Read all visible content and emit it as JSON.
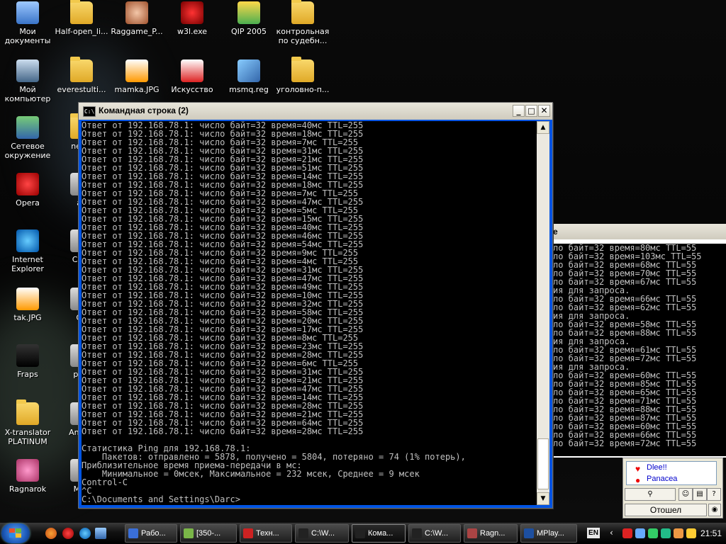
{
  "desktop_icons": [
    {
      "label": "Мои документы",
      "icon": "my-documents-icon"
    },
    {
      "label": "Half-open_li...",
      "icon": "folder-icon"
    },
    {
      "label": "Raggame_P...",
      "icon": "anime-character-icon"
    },
    {
      "label": "w3l.exe",
      "icon": "biohazard-icon"
    },
    {
      "label": "QIP 2005",
      "icon": "qip-icon"
    },
    {
      "label": "контрольная по судебн...",
      "icon": "folder-icon"
    },
    {
      "label": "Мой компьютер",
      "icon": "my-computer-icon"
    },
    {
      "label": "everestulti...",
      "icon": "folder-icon"
    },
    {
      "label": "mamka.JPG",
      "icon": "jpg-file-icon"
    },
    {
      "label": "Искусство",
      "icon": "pdf-file-icon"
    },
    {
      "label": "msmq.reg",
      "icon": "registry-file-icon"
    },
    {
      "label": "уголовно-п...",
      "icon": "folder-icon"
    },
    {
      "label": "Сетевое окружение",
      "icon": "network-icon"
    },
    {
      "label": "neutr",
      "icon": "folder-icon"
    },
    {
      "label": "Opera",
      "icon": "opera-icon"
    },
    {
      "label": "aa",
      "icon": "file-icon"
    },
    {
      "label": "Internet Explorer",
      "icon": "ie-icon"
    },
    {
      "label": "CP_T",
      "icon": "file-icon"
    },
    {
      "label": "tak.JPG",
      "icon": "jpg-file-icon"
    },
    {
      "label": "Ga",
      "icon": "file-icon"
    },
    {
      "label": "Fraps",
      "icon": "fraps-icon"
    },
    {
      "label": "play",
      "icon": "file-icon"
    },
    {
      "label": "X-translator PLATINUM",
      "icon": "folder-icon"
    },
    {
      "label": "Anb Cl",
      "icon": "file-icon"
    },
    {
      "label": "Ragnarok",
      "icon": "ragnarok-icon"
    },
    {
      "label": "Моя",
      "icon": "file-icon"
    }
  ],
  "cmd_window": {
    "title": "Командная строка (2)",
    "icon_text": "C:\\",
    "buttons": {
      "minimize": "_",
      "maximize": "□",
      "close": "✕"
    },
    "lines": [
      "Ответ от 192.168.78.1: число байт=32 время=40мс TTL=255",
      "Ответ от 192.168.78.1: число байт=32 время=18мс TTL=255",
      "Ответ от 192.168.78.1: число байт=32 время=7мс TTL=255",
      "Ответ от 192.168.78.1: число байт=32 время=31мс TTL=255",
      "Ответ от 192.168.78.1: число байт=32 время=21мс TTL=255",
      "Ответ от 192.168.78.1: число байт=32 время=51мс TTL=255",
      "Ответ от 192.168.78.1: число байт=32 время=14мс TTL=255",
      "Ответ от 192.168.78.1: число байт=32 время=18мс TTL=255",
      "Ответ от 192.168.78.1: число байт=32 время=7мс TTL=255",
      "Ответ от 192.168.78.1: число байт=32 время=47мс TTL=255",
      "Ответ от 192.168.78.1: число байт=32 время=5мс TTL=255",
      "Ответ от 192.168.78.1: число байт=32 время=15мс TTL=255",
      "Ответ от 192.168.78.1: число байт=32 время=40мс TTL=255",
      "Ответ от 192.168.78.1: число байт=32 время=46мс TTL=255",
      "Ответ от 192.168.78.1: число байт=32 время=54мс TTL=255",
      "Ответ от 192.168.78.1: число байт=32 время=9мс TTL=255",
      "Ответ от 192.168.78.1: число байт=32 время=4мс TTL=255",
      "Ответ от 192.168.78.1: число байт=32 время=31мс TTL=255",
      "Ответ от 192.168.78.1: число байт=32 время=47мс TTL=255",
      "Ответ от 192.168.78.1: число байт=32 время=49мс TTL=255",
      "Ответ от 192.168.78.1: число байт=32 время=10мс TTL=255",
      "Ответ от 192.168.78.1: число байт=32 время=32мс TTL=255",
      "Ответ от 192.168.78.1: число байт=32 время=58мс TTL=255",
      "Ответ от 192.168.78.1: число байт=32 время=20мс TTL=255",
      "Ответ от 192.168.78.1: число байт=32 время=17мс TTL=255",
      "Ответ от 192.168.78.1: число байт=32 время=8мс TTL=255",
      "Ответ от 192.168.78.1: число байт=32 время=23мс TTL=255",
      "Ответ от 192.168.78.1: число байт=32 время=28мс TTL=255",
      "Ответ от 192.168.78.1: число байт=32 время=6мс TTL=255",
      "Ответ от 192.168.78.1: число байт=32 время=31мс TTL=255",
      "Ответ от 192.168.78.1: число байт=32 время=21мс TTL=255",
      "Ответ от 192.168.78.1: число байт=32 время=47мс TTL=255",
      "Ответ от 192.168.78.1: число байт=32 время=14мс TTL=255",
      "Ответ от 192.168.78.1: число байт=32 время=28мс TTL=255",
      "Ответ от 192.168.78.1: число байт=32 время=21мс TTL=255",
      "Ответ от 192.168.78.1: число байт=32 время=64мс TTL=255",
      "Ответ от 192.168.78.1: число байт=32 время=28мс TTL=255",
      "",
      "Статистика Ping для 192.168.78.1:",
      "    Пакетов: отправлено = 5878, получено = 5804, потеряно = 74 (1% потерь),",
      "Приблизительное время приема-передачи в мс:",
      "    Минимальное = 0мсек, Максимальное = 232 мсек, Среднее = 9 мсек",
      "Control-C",
      "^C",
      "C:\\Documents and Settings\\Darc>"
    ]
  },
  "back_window": {
    "title": "е",
    "lines": [
      "ло байт=32 время=80мс TTL=55",
      "ло байт=32 время=103мс TTL=55",
      "ло байт=32 время=68мс TTL=55",
      "ло байт=32 время=70мс TTL=55",
      "ло байт=32 время=67мс TTL=55",
      "ия для запроса.",
      "ло байт=32 время=66мс TTL=55",
      "ло байт=32 время=62мс TTL=55",
      "ия для запроса.",
      "ло байт=32 время=58мс TTL=55",
      "ло байт=32 время=88мс TTL=55",
      "ия для запроса.",
      "ло байт=32 время=61мс TTL=55",
      "ло байт=32 время=72мс TTL=55",
      "ия для запроса.",
      "ло байт=32 время=60мс TTL=55",
      "ло байт=32 время=85мс TTL=55",
      "ло байт=32 время=65мс TTL=55",
      "ло байт=32 время=71мс TTL=55",
      "ло байт=32 время=88мс TTL=55",
      "ло байт=32 время=87мс TTL=55",
      "ло байт=32 время=60мс TTL=55",
      "ло байт=32 время=66мс TTL=55",
      "ло байт=32 время=72мс TTL=55"
    ]
  },
  "qip": {
    "contacts": [
      "Dlee!!",
      "Panacea"
    ],
    "status_label": "Отошел"
  },
  "taskbar": {
    "tasks": [
      {
        "label": "Рабо...",
        "color": "#3a6fd8"
      },
      {
        "label": "[350-...",
        "color": "#7ab648"
      },
      {
        "label": "Техн...",
        "color": "#cc2222"
      },
      {
        "label": "C:\\W...",
        "color": "#222222"
      },
      {
        "label": "Кома...",
        "color": "#222222",
        "active": true
      },
      {
        "label": "C:\\W...",
        "color": "#222222"
      },
      {
        "label": "Ragn...",
        "color": "#aa4444"
      },
      {
        "label": "MPlay...",
        "color": "#1d4fa0"
      }
    ],
    "language": "EN",
    "clock": "21:51"
  }
}
